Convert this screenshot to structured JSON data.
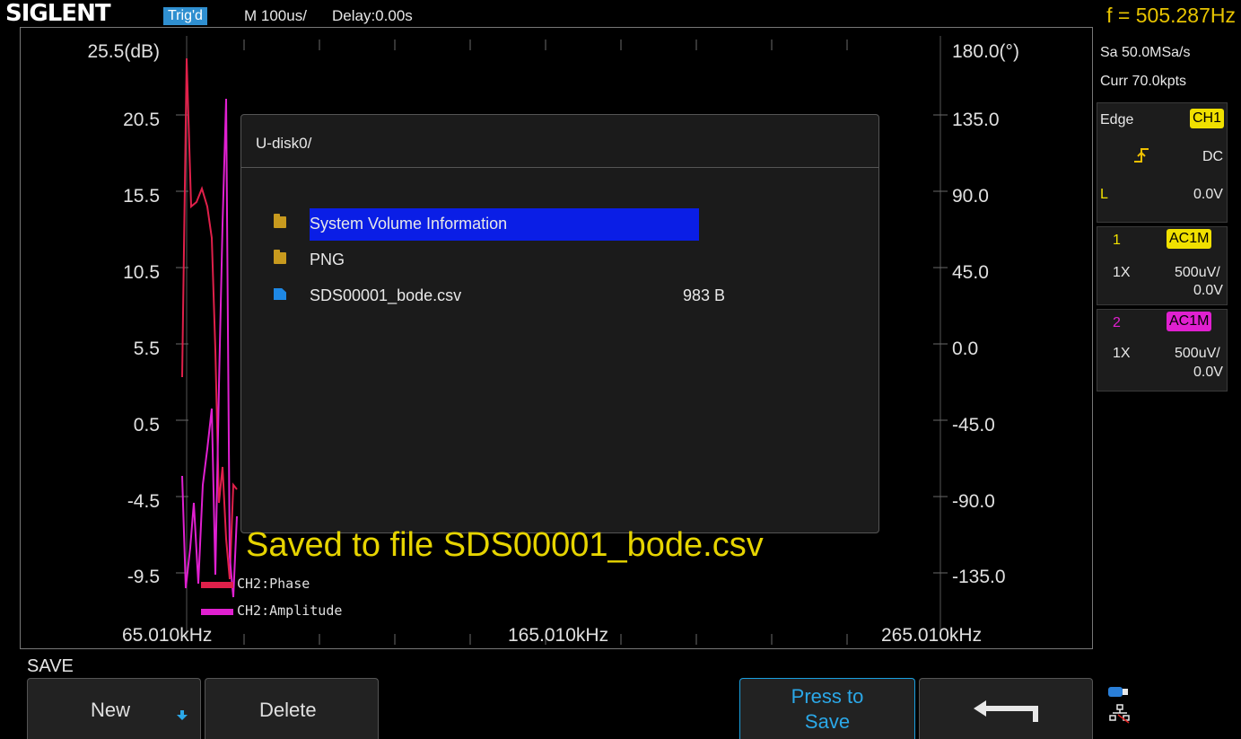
{
  "topbar": {
    "logo": "SIGLENT",
    "trigger_status": "Trig'd",
    "timebase": "M 100us/",
    "delay": "Delay:0.00s",
    "frequency": "f = 505.287Hz"
  },
  "plot": {
    "y_left_ticks": [
      "25.5(dB)",
      "20.5",
      "15.5",
      "10.5",
      "5.5",
      "0.5",
      "-4.5",
      "-9.5"
    ],
    "y_right_ticks": [
      "180.0(°)",
      "135.0",
      "90.0",
      "45.0",
      "0.0",
      "-45.0",
      "-90.0",
      "-135.0"
    ],
    "x_ticks": [
      "65.010kHz",
      "165.010kHz",
      "265.010kHz"
    ],
    "legend": [
      {
        "label": "CH2:Phase",
        "color": "#e0204a"
      },
      {
        "label": "CH2:Amplitude",
        "color": "#e020d0"
      }
    ]
  },
  "dialog": {
    "path": "U-disk0/",
    "files": [
      {
        "icon": "folder-icon",
        "name": "System Volume Information",
        "size": "",
        "selected": true
      },
      {
        "icon": "folder-icon",
        "name": "PNG",
        "size": "",
        "selected": false
      },
      {
        "icon": "file-icon",
        "name": "SDS00001_bode.csv",
        "size": "983 B",
        "selected": false
      }
    ]
  },
  "message": "Saved to file SDS00001_bode.csv",
  "right_panel": {
    "sample_rate": "Sa 50.0MSa/s",
    "curr_points": "Curr 70.0kpts",
    "trigger_type": "Edge",
    "trigger_source": "CH1",
    "trigger_coupling": "DC",
    "trigger_level_label": "L",
    "trigger_level": "0.0V",
    "channels": [
      {
        "number": "1",
        "coupling": "AC1M",
        "probe": "1X",
        "scale": "500uV/",
        "offset": "0.0V",
        "color": "#f0e000"
      },
      {
        "number": "2",
        "coupling": "AC1M",
        "probe": "1X",
        "scale": "500uV/",
        "offset": "0.0V",
        "color": "#e020d0"
      }
    ]
  },
  "bottom": {
    "menu_title": "SAVE",
    "softkeys": {
      "new": "New",
      "delete": "Delete",
      "press_to_save_line1": "Press to",
      "press_to_save_line2": "Save"
    }
  },
  "colors": {
    "accent": "#1aa0e0",
    "message": "#e6d400",
    "frequency": "#e8c400",
    "selection": "#0a1ee6"
  }
}
